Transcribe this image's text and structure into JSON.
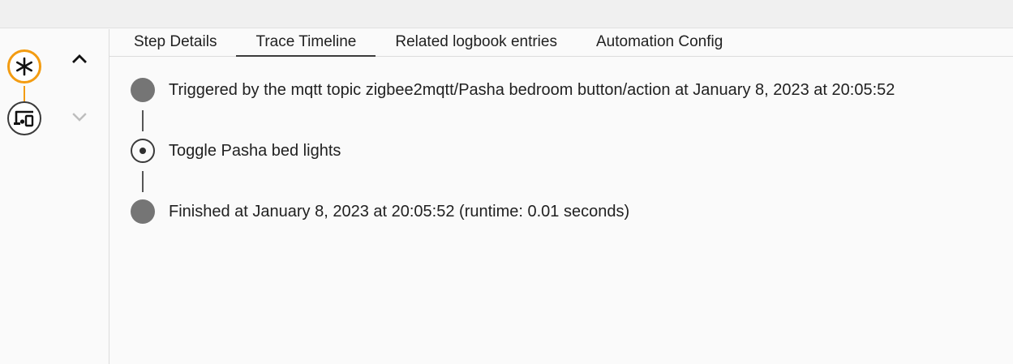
{
  "tabs": [
    {
      "label": "Step Details",
      "active": false
    },
    {
      "label": "Trace Timeline",
      "active": true
    },
    {
      "label": "Related logbook entries",
      "active": false
    },
    {
      "label": "Automation Config",
      "active": false
    }
  ],
  "graph": {
    "nodes": [
      {
        "icon": "asterisk-icon",
        "type": "trigger",
        "color": "#f39c12"
      },
      {
        "icon": "devices-icon",
        "type": "action",
        "color": "#3a3a3a"
      }
    ],
    "nav": {
      "up_icon": "chevron-up-icon",
      "down_icon": "chevron-down-icon",
      "down_enabled": false
    }
  },
  "timeline": [
    {
      "text": "Triggered by the mqtt topic zigbee2mqtt/Pasha bedroom button/action at January 8, 2023 at 20:05:52",
      "marker": "filled"
    },
    {
      "text": "Toggle Pasha bed lights",
      "marker": "ring"
    },
    {
      "text": "Finished at January 8, 2023 at 20:05:52 (runtime: 0.01 seconds)",
      "marker": "filled"
    }
  ]
}
